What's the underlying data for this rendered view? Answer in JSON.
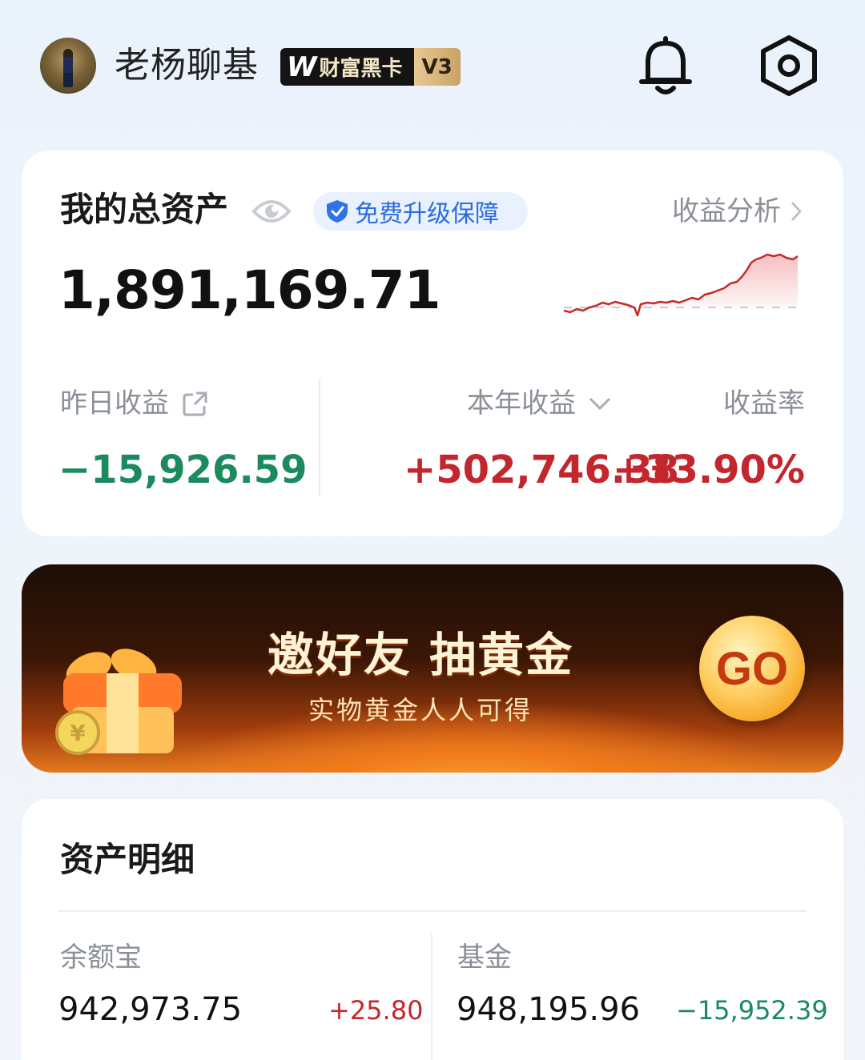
{
  "header": {
    "username": "老杨聊基",
    "vip_brand": "财富黑卡",
    "vip_level": "V3"
  },
  "asset_card": {
    "title": "我的总资产",
    "protect_label": "免费升级保障",
    "analysis_label": "收益分析",
    "total_value": "1,891,169.71",
    "yesterday_label": "昨日收益",
    "yesterday_value": "−15,926.59",
    "year_label": "本年收益",
    "year_value": "+502,746.38",
    "rate_label": "收益率",
    "rate_value": "+33.90%"
  },
  "banner": {
    "title": "邀好友 抽黄金",
    "subtitle": "实物黄金人人可得",
    "go_label": "GO"
  },
  "detail_card": {
    "title": "资产明细",
    "items": [
      {
        "label": "余额宝",
        "value": "942,973.75",
        "change": "+25.80",
        "change_color": "#c4262e"
      },
      {
        "label": "基金",
        "value": "948,195.96",
        "change": "−15,952.39",
        "change_color": "#1b8a5e"
      }
    ]
  },
  "colors": {
    "gain": "#c4262e",
    "loss": "#1b8a5e",
    "accent_blue": "#2a6be0"
  }
}
